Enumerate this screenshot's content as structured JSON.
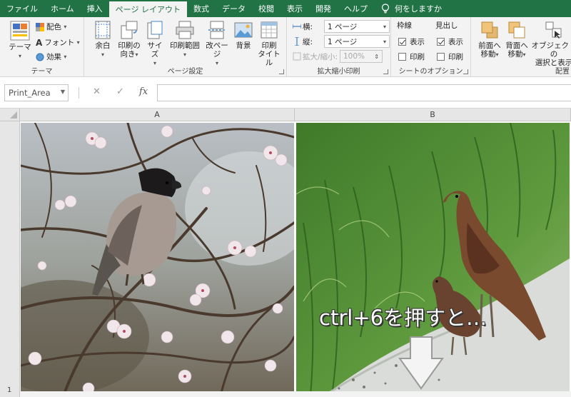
{
  "tabs": [
    {
      "label": "ファイル"
    },
    {
      "label": "ホーム"
    },
    {
      "label": "挿入"
    },
    {
      "label": "ページ レイアウト"
    },
    {
      "label": "数式"
    },
    {
      "label": "データ"
    },
    {
      "label": "校閲"
    },
    {
      "label": "表示"
    },
    {
      "label": "開発"
    },
    {
      "label": "ヘルプ"
    }
  ],
  "tell_me": "何をしますか",
  "ribbon": {
    "theme": {
      "group_label": "テーマ",
      "theme_btn": "テーマ",
      "colors": "配色",
      "fonts": "フォント",
      "effects": "効果"
    },
    "page_setup": {
      "group_label": "ページ設定",
      "margins": "余白",
      "orientation_1": "印刷の",
      "orientation_2": "向き",
      "size": "サイズ",
      "print_area": "印刷範囲",
      "breaks": "改ページ",
      "background": "背景",
      "print_titles_1": "印刷",
      "print_titles_2": "タイトル"
    },
    "scale": {
      "group_label": "拡大縮小印刷",
      "width_label": "横:",
      "width_value": "1 ページ",
      "height_label": "縦:",
      "height_value": "1 ページ",
      "scale_label": "拡大/縮小:",
      "scale_value": "100%"
    },
    "sheet_options": {
      "group_label": "シートのオプション",
      "gridlines": "枠線",
      "headings": "見出し",
      "view": "表示",
      "print": "印刷",
      "gridlines_view": true,
      "gridlines_print": false,
      "headings_view": true,
      "headings_print": false
    },
    "arrange": {
      "group_label": "配置",
      "bring_forward_1": "前面へ",
      "bring_forward_2": "移動",
      "send_backward_1": "背面へ",
      "send_backward_2": "移動",
      "selection_1": "オブジェクトの",
      "selection_2": "選択と表示"
    }
  },
  "formula_bar": {
    "name_box": "Print_Area",
    "cancel": "✕",
    "enter": "✓",
    "fx": "fx",
    "value": ""
  },
  "grid": {
    "columns": [
      "A",
      "B"
    ],
    "row_number": "1"
  },
  "caption": "ctrl+6を押すと…",
  "colors": {
    "accent": "#217346"
  }
}
